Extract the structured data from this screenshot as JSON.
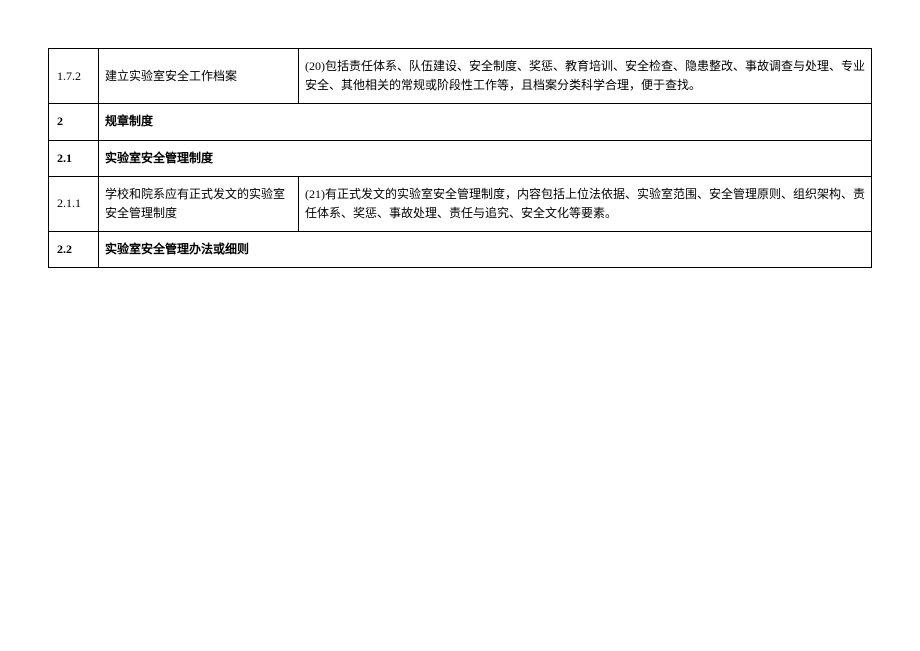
{
  "rows": [
    {
      "id": "1.7.2",
      "title": "建立实验室安全工作档案",
      "desc": "(20)包括责任体系、队伍建设、安全制度、奖惩、教育培训、安全检查、隐患整改、事故调查与处理、专业安全、其他相关的常规或阶段性工作等，且档案分类科学合理，便于查找。",
      "bold": false,
      "span": false
    },
    {
      "id": "2",
      "title": "规章制度",
      "desc": "",
      "bold": true,
      "span": true
    },
    {
      "id": "2.1",
      "title": "实验室安全管理制度",
      "desc": "",
      "bold": true,
      "span": true
    },
    {
      "id": "2.1.1",
      "title": "学校和院系应有正式发文的实验室安全管理制度",
      "desc": "(21)有正式发文的实验室安全管理制度，内容包括上位法依据、实验室范围、安全管理原则、组织架构、责任体系、奖惩、事故处理、责任与追究、安全文化等要素。",
      "bold": false,
      "span": false
    },
    {
      "id": "2.2",
      "title": "实验室安全管理办法或细则",
      "desc": "",
      "bold": true,
      "span": true
    }
  ]
}
